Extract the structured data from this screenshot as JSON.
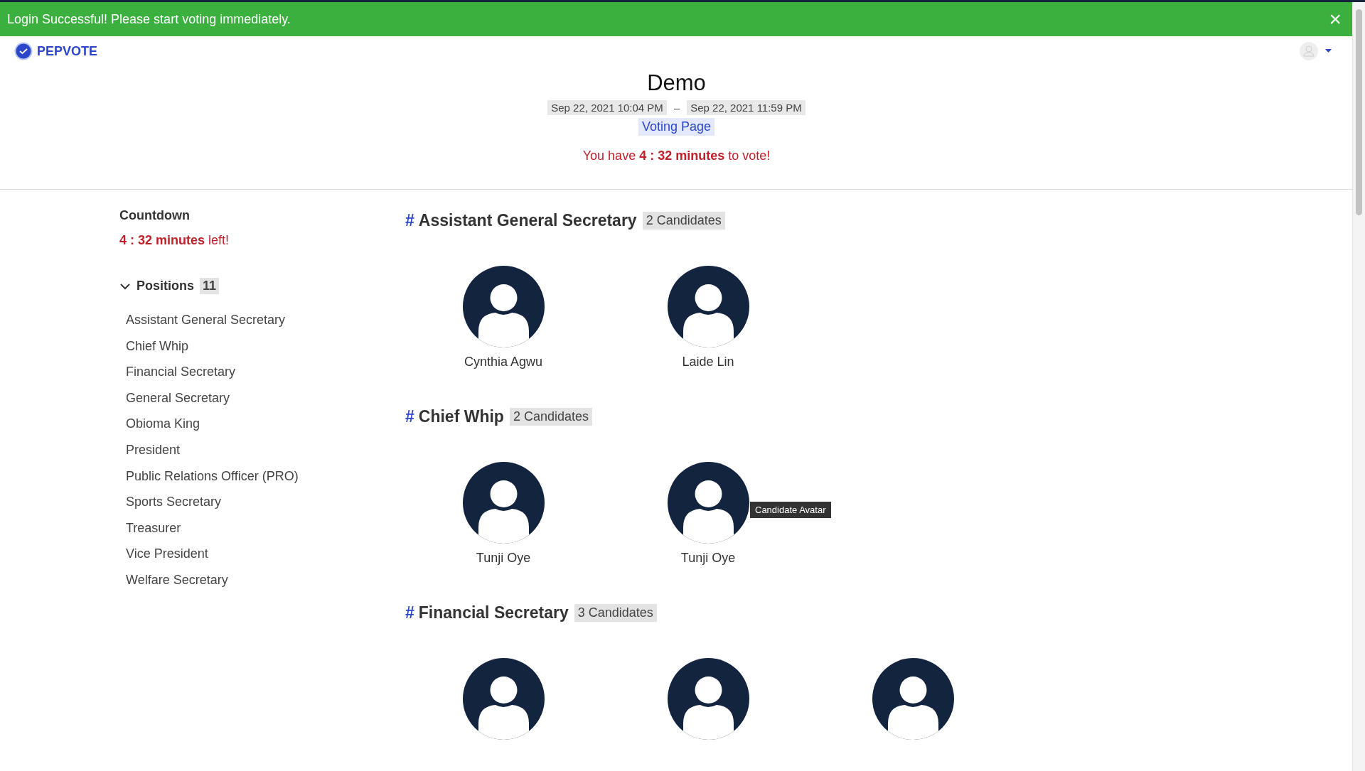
{
  "alert": {
    "message": "Login Successful! Please start voting immediately.",
    "close": "×"
  },
  "brand": {
    "name": "PEPVOTE"
  },
  "election": {
    "title": "Demo",
    "start": "Sep 22, 2021 10:04 PM",
    "separator": "–",
    "end": "Sep 22, 2021 11:59 PM",
    "page_label": "Voting Page",
    "time_message": "You have **4 : 32 minutes** to vote!"
  },
  "sidebar": {
    "countdown_title": "Countdown",
    "countdown_text": "**4 : 32 minutes** left!",
    "positions_title": "Positions",
    "positions_count": "11",
    "expanded": true,
    "items": [
      "Assistant General Secretary",
      "Chief Whip",
      "Financial Secretary",
      "General Secretary",
      "Obioma King",
      "President",
      "Public Relations Officer (PRO)",
      "Sports Secretary",
      "Treasurer",
      "Vice President",
      "Welfare Secretary"
    ]
  },
  "sections": [
    {
      "marker": "#",
      "title": "Assistant General Secretary",
      "count": "2 Candidates",
      "candidates": [
        {
          "kind": "named",
          "name": "Cynthia Agwu"
        },
        {
          "kind": "named",
          "name": "Laide Lin"
        }
      ]
    },
    {
      "marker": "#",
      "title": "Chief Whip",
      "count": "2 Candidates",
      "candidates": [
        {
          "kind": "named",
          "name": "Tunji Oye"
        },
        {
          "kind": "named",
          "name": "Tunji Oye",
          "tooltip": "Candidate Avatar"
        }
      ]
    },
    {
      "marker": "#",
      "title": "Financial Secretary",
      "count": "3 Candidates",
      "candidates": [
        {
          "kind": "avatar"
        },
        {
          "kind": "avatar"
        },
        {
          "kind": "avatar"
        }
      ]
    }
  ]
}
